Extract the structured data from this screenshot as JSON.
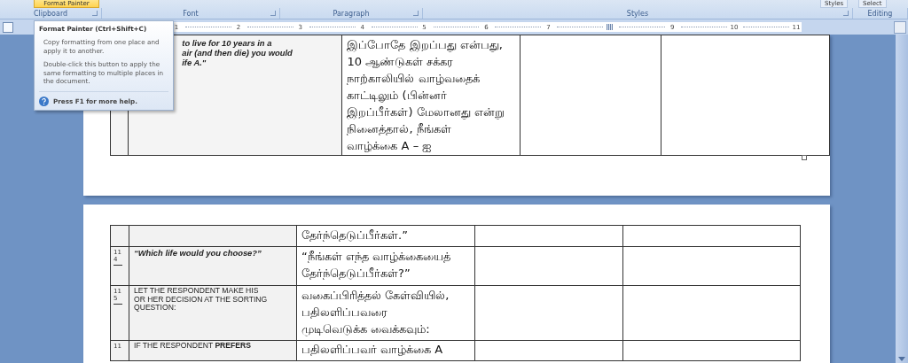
{
  "ribbon": {
    "buttons": [
      {
        "label": "Format Painter",
        "hovered": true
      },
      {
        "label": "Styles",
        "hovered": false
      },
      {
        "label": "Select",
        "hovered": false
      }
    ],
    "groups": [
      {
        "label": "Clipboard",
        "launcher": true
      },
      {
        "label": "Font",
        "launcher": true
      },
      {
        "label": "Paragraph",
        "launcher": true
      },
      {
        "label": "Styles",
        "launcher": true
      },
      {
        "label": "Editing",
        "launcher": false
      }
    ]
  },
  "ruler": {
    "marks": [
      {
        "kind": "number",
        "label": "1"
      },
      {
        "kind": "number",
        "label": "2"
      },
      {
        "kind": "number",
        "label": "3"
      },
      {
        "kind": "number",
        "label": "4"
      },
      {
        "kind": "number",
        "label": "5"
      },
      {
        "kind": "number",
        "label": "6"
      },
      {
        "kind": "number",
        "label": "7"
      },
      {
        "kind": "column"
      },
      {
        "kind": "number",
        "label": "9"
      },
      {
        "kind": "number",
        "label": "10"
      },
      {
        "kind": "number",
        "label": "11"
      }
    ]
  },
  "tooltip": {
    "title": "Format Painter (Ctrl+Shift+C)",
    "paragraphs": [
      "Copy formatting from one place and apply it to another.",
      "Double-click this button to apply the same formatting to multiple places in the document."
    ],
    "help": "Press F1 for more help."
  },
  "pages": [
    {
      "rows": [
        {
          "number": [],
          "english": {
            "kind": "quote",
            "lines": [
              "to live for 10 years in a",
              "air (and then die) you would",
              "ife A.\""
            ]
          },
          "tamil": [
            "இப்போதே இறப்பது என்பது,",
            "10 ஆண்டுகள் சக்கர",
            "நாற்காலியில் வாழ்வதைக்",
            "காட்டிலும் (பின்னர்",
            "இறப்பீர்கள்) மேலானது என்று",
            "நினைத்தால், நீங்கள்",
            "வாழ்க்கை A – ஐ"
          ]
        }
      ]
    },
    {
      "rows": [
        {
          "number": [],
          "english": {
            "kind": "empty"
          },
          "tamil": [
            "தேர்ந்தெடுப்பீர்கள்.”"
          ]
        },
        {
          "number": [
            "11",
            "4"
          ],
          "english": {
            "kind": "quote",
            "lines": [
              "“Which life would you choose?”"
            ]
          },
          "tamil": [
            "“நீங்கள் எந்த வாழ்க்கையைத்",
            "தேர்ந்தெடுப்பீர்கள்?”"
          ]
        },
        {
          "number": [
            "11",
            "5"
          ],
          "english": {
            "kind": "instruction",
            "lines": [
              "LET THE  RESPONDENT  MAKE HIS",
              "OR HER DECISION  AT THE  SORTING",
              "QUESTION:"
            ]
          },
          "tamil": [
            "வகைப்பிரித்தல் கேள்வியில்,",
            "பதிலளிப்பவரை",
            "முடிவெடுக்க வைக்கவும்:"
          ]
        },
        {
          "number": [
            "11"
          ],
          "english": {
            "kind": "instruction",
            "lines": [
              "IF THE  RESPONDENT **PREFERS**"
            ]
          },
          "tamil": [
            "பதிலளிப்பவர் வாழ்க்கை A"
          ]
        }
      ]
    }
  ]
}
